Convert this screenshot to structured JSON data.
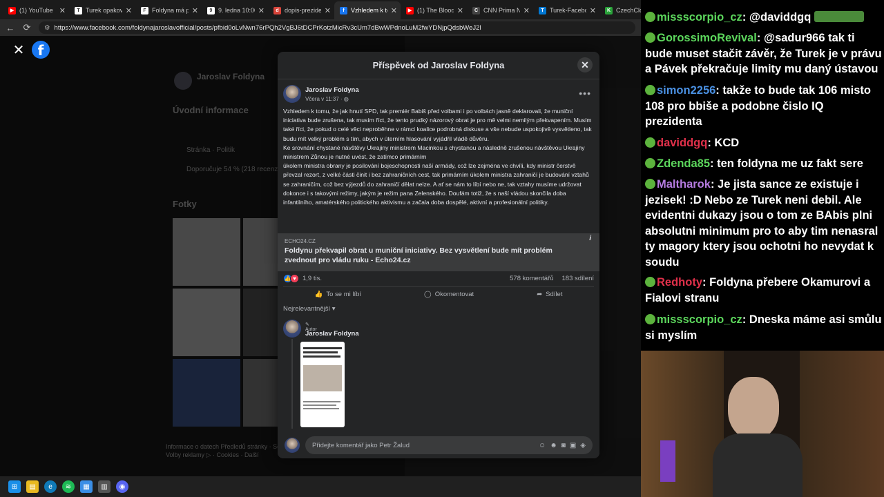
{
  "browser": {
    "tabs": [
      {
        "title": "(1) YouTube",
        "color": "#ff0000",
        "glyph": "▶"
      },
      {
        "title": "Turek opakovan",
        "color": "#ffffff",
        "glyph": "T"
      },
      {
        "title": "Foldyna má pro",
        "color": "#ffffff",
        "glyph": "F"
      },
      {
        "title": "9. ledna 10:00 -",
        "color": "#ffffff",
        "glyph": "9"
      },
      {
        "title": "dopis-prezident",
        "color": "#d9443a",
        "glyph": "d"
      },
      {
        "title": "Vzhledem k tom",
        "color": "#1877f2",
        "glyph": "f",
        "active": true
      },
      {
        "title": "(1) The Blood of",
        "color": "#ff0000",
        "glyph": "▶"
      },
      {
        "title": "CNN Prima New",
        "color": "#444444",
        "glyph": "C"
      },
      {
        "title": "Turek-Facebook",
        "color": "#0078d4",
        "glyph": "T"
      },
      {
        "title": "CzechCloud Stre",
        "color": "#2aa33a",
        "glyph": "K"
      }
    ],
    "tab_close": "✕",
    "url": "https://www.facebook.com/foldynajaroslavofficial/posts/pfbid0oLvNwn76rPQh2VgBJ6tDCPrKotzMicRv3cUm7dBwWPdnoLuM2fwYDNjpQdsbWeJ2l"
  },
  "background": {
    "profile_name": "Jaroslav Foldyna",
    "intro_heading": "Úvodní informace",
    "intro_item1": "Stránka · Politik",
    "intro_item2": "Doporučuje 54 % (218 recenzí)",
    "photos_heading": "Fotky",
    "footer1": "Informace o datech Předledů stránky · So",
    "footer2": "Volby reklamy ▷ · Cookies · Další",
    "right_snip1": "po volbá",
    "right_snip2": "vyslenti bude m",
    "right_snip3": "578 kc"
  },
  "modal": {
    "title": "Příspěvek od Jaroslav Foldyna",
    "author": "Jaroslav Foldyna",
    "time": "Včera v 11:37 ·",
    "post_paragraphs": [
      "Vzhledem k tomu, že jak hnutí SPD, tak premiér Babiš před volbami i po volbách jasně deklarovali, že muniční iniciativa bude zrušena, tak musím říct, že tento prudký názorový obrat je pro mě velmi nemilým překvapením. Musím také říci, že pokud o celé věci neproběhne v rámci koalice podrobná diskuse a vše nebude uspokojivě vysvětleno, tak budu mít velký problém s tím, abych v úterním hlasování vyjádřil vládě důvěru.",
      "Ke srovnání chystané návštěvy Ukrajiny ministrem Macinkou s chystanou a následně zrušenou návštěvou Ukrajiny ministrem Zůnou je nutné uvést, že zatímco primárním",
      "úkolem ministra obrany je posilování bojeschopnosti naší armády, což lze zejména ve chvíli, kdy ministr čerstvě převzal rezort, z velké části činit i bez zahraničních cest, tak primárním úkolem ministra zahraničí je budování vztahů se zahraničím, což bez výjezdů do zahraničí dělat nelze. A ať se nám to líbí nebo ne, tak vztahy musíme udržovat dokonce i s takovými režimy, jakým je režim pana Zelenského. Doufám totiž, že s naší vládou skončila doba infantilního, amatérského politického aktivismu a začala doba dospělé, aktivní a profesionální politiky."
    ],
    "link_domain": "ECHO24.CZ",
    "link_title": "Foldynu překvapil obrat u muniční iniciativy. Bez vysvětlení bude mít problém zvednout pro vládu ruku - Echo24.cz",
    "reactions": "1,9 tis.",
    "comments_count": "578 komentářů",
    "shares_count": "183 sdílení",
    "like_label": "To se mi líbí",
    "comment_label": "Okomentovat",
    "share_label": "Sdílet",
    "sort_label": "Nejrelevantnější",
    "comment_badge": "Autor",
    "comment_author": "Jaroslav Foldyna",
    "comment_placeholder": "Přidejte komentář jako Petr Žalud"
  },
  "chat": {
    "messages": [
      {
        "user": "GorossimoRevival",
        "color": "#5cd65c",
        "text": " @sadur966 tak ti bude muset stačit závěr, že Turek je v právu a Pávek překračuje limity mu daný ústavou"
      },
      {
        "user": "simon2256",
        "color": "#4a90e2",
        "text": " takže to bude tak 106 misto 108 pro bbiše a podobne čislo IQ prezidenta"
      },
      {
        "user": "daviddgq",
        "color": "#e0304a",
        "text": " KCD"
      },
      {
        "user": "Zdenda85",
        "color": "#5cd65c",
        "text": " ten foldyna me uz fakt sere"
      },
      {
        "user": "Maltharok",
        "color": "#b57be0",
        "text": " Je jista sance ze existuje i jezisek! :D Nebo ze Turek neni debil. Ale evidentni dukazy jsou o tom ze BAbis plni absolutni minimum pro to aby tim nenasral ty magory ktery jsou ochotni ho nevydat k soudu"
      },
      {
        "user": "Redhoty",
        "color": "#e0304a",
        "text": " Foldyna přebere Okamurovi a Fialovi stranu"
      },
      {
        "user": "missscorpio_cz",
        "color": "#5cd65c",
        "text": " Dneska máme asi smůlu si myslím"
      }
    ],
    "top_user": "missscorpio_cz",
    "top_text": " @daviddgq"
  },
  "colors": {
    "fb_blue": "#1877f2",
    "modal_bg": "#242526",
    "chat_green": "#5cd65c"
  }
}
